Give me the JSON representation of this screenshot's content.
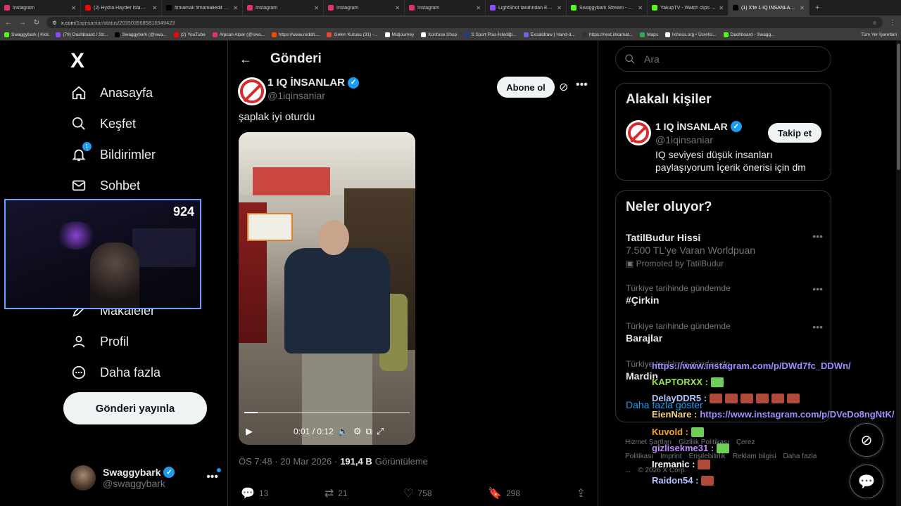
{
  "browser": {
    "tabs": [
      {
        "title": "Instagram",
        "color": "#e1306c"
      },
      {
        "title": "(2) Hydra Hayder Islamic Cartoon",
        "color": "#ff0000"
      },
      {
        "title": "#imamali #mamaliedit #wisdom",
        "color": "#000000"
      },
      {
        "title": "Instagram",
        "color": "#e1306c"
      },
      {
        "title": "Instagram",
        "color": "#e1306c"
      },
      {
        "title": "Instagram",
        "color": "#e1306c"
      },
      {
        "title": "LightShot tarafından Ekran Görüntüsü",
        "color": "#8a4fff"
      },
      {
        "title": "Swaggybark Stream - Watch Live",
        "color": "#53fc18"
      },
      {
        "title": "YakupTV - Watch clips on Kick",
        "color": "#53fc18"
      },
      {
        "title": "(1) X'te 1 IQ İNSANLAR: \"şaplak\"",
        "color": "#000000"
      }
    ],
    "url_host": "x.com",
    "url_path": "/1iqinsaniar/status/2035035685816549423",
    "bookmarks": [
      "Swaggybark | Kick",
      "(79) Dashboard / Str...",
      "Swaggybark (@swa...",
      "(2) YouTube",
      "Alpcan Alpar (@swa...",
      "https://www.reddit....",
      "Gelen Kutusu (31) -...",
      "Midjourney",
      "Konfuse Shop",
      "S Sport Plus-İstediği...",
      "Excalidraw | Hand-d...",
      "https://next.inkarnat...",
      "Maps",
      "lichess.org • Ücretsi...",
      "Dashboard - Swagg..."
    ],
    "bookmarks_all": "Tüm Yer İşaretleri"
  },
  "nav": {
    "logo": "X",
    "items": [
      {
        "label": "Anasayfa",
        "icon": "home-icon"
      },
      {
        "label": "Keşfet",
        "icon": "search-icon"
      },
      {
        "label": "Bildirimler",
        "icon": "bell-icon",
        "badge": "1"
      },
      {
        "label": "Sohbet",
        "icon": "mail-icon"
      },
      {
        "label": "Makaleler",
        "icon": "article-icon"
      },
      {
        "label": "Profil",
        "icon": "profile-icon"
      },
      {
        "label": "Daha fazla",
        "icon": "more-circle-icon"
      }
    ],
    "post_button": "Gönderi yayınla",
    "account": {
      "name": "Swaggybark",
      "handle": "@swaggybark"
    }
  },
  "webcam": {
    "viewer_count": "924"
  },
  "feed": {
    "title": "Gönderi",
    "post": {
      "author": "1 IQ İNSANLAR",
      "handle": "@1iqinsaniar",
      "subscribe": "Abone ol",
      "text": "şaplak iyi oturdu",
      "video_time": "0:01 / 0:12",
      "video_progress": 0.08,
      "timestamp": "ÖS 7:48 · 20 Mar 2026 ·",
      "views_value": "191,4 B",
      "views_label": "Görüntüleme",
      "replies": "13",
      "reposts": "21",
      "likes": "758",
      "bookmarks": "298"
    }
  },
  "sidebar": {
    "search_placeholder": "Ara",
    "related_title": "Alakalı kişiler",
    "related": {
      "name": "1 IQ İNSANLAR",
      "handle": "@1iqinsaniar",
      "follow": "Takip et",
      "bio": "IQ seviyesi düşük insanları paylaşıyorum İçerik önerisi için dm"
    },
    "trends_title": "Neler oluyor?",
    "trends": [
      {
        "ctx": "",
        "name": "TatilBudur Hissi",
        "sub": "7.500 TL'ye Varan Worldpuan",
        "promo": "Promoted by TatilBudur"
      },
      {
        "ctx": "Türkiye tarihinde gündemde",
        "name": "#Çirkin"
      },
      {
        "ctx": "Türkiye tarihinde gündemde",
        "name": "Barajlar"
      },
      {
        "ctx": "Türkiye tarihinde gündemde",
        "name": "Mardin"
      }
    ],
    "show_more": "Daha fazla göster",
    "footer": [
      "Hizmet Şartları",
      "Gizlilik Politikası",
      "Çerez Politikası",
      "Imprint",
      "Erişilebilirlik",
      "Reklam bilgisi",
      "Daha fazla ...",
      "© 2026 X Corp."
    ]
  },
  "chat": [
    {
      "user": "",
      "msg": "https://www.instagram.com/p/DWd7fc_DDWn/",
      "user_color": "#a68bff"
    },
    {
      "user": "KAPTORXX :",
      "msg": "",
      "user_color": "#9be34a"
    },
    {
      "user": "DelayDDR5 :",
      "msg": "",
      "user_color": "#b7c4ff"
    },
    {
      "user": "EienNare :",
      "msg": "https://www.instagram.com/p/DVeDo8ngNtK/",
      "user_color": "#f3d27c"
    },
    {
      "user": "Kuvold :",
      "msg": "",
      "user_color": "#f5a623"
    },
    {
      "user": "gizlisekme31 :",
      "msg": "",
      "user_color": "#c08bff"
    },
    {
      "user": "Iremanic :",
      "msg": "",
      "user_color": "#ffffff"
    },
    {
      "user": "Raidon54 :",
      "msg": "",
      "user_color": "#b7c4ff"
    }
  ]
}
